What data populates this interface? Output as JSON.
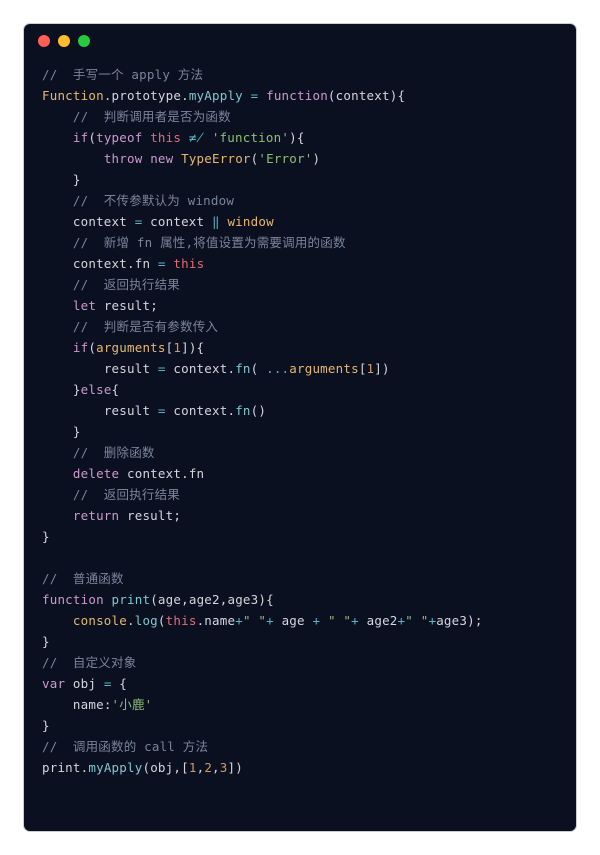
{
  "titlebar": {
    "buttons": [
      "close",
      "minimize",
      "zoom"
    ]
  },
  "code": {
    "lines": [
      [
        [
          "comment",
          "//  手写一个 apply 方法"
        ]
      ],
      [
        [
          "builtin",
          "Function"
        ],
        [
          "punct",
          "."
        ],
        [
          "prop",
          "prototype"
        ],
        [
          "punct",
          "."
        ],
        [
          "func",
          "myApply"
        ],
        [
          "ident",
          " "
        ],
        [
          "op",
          "="
        ],
        [
          "ident",
          " "
        ],
        [
          "keyword",
          "function"
        ],
        [
          "punct",
          "("
        ],
        [
          "ident",
          "context"
        ],
        [
          "punct",
          "){"
        ]
      ],
      [
        [
          "indent",
          "    "
        ],
        [
          "comment",
          "//  判断调用者是否为函数"
        ]
      ],
      [
        [
          "indent",
          "    "
        ],
        [
          "keyword",
          "if"
        ],
        [
          "punct",
          "("
        ],
        [
          "keyword",
          "typeof"
        ],
        [
          "ident",
          " "
        ],
        [
          "this",
          "this"
        ],
        [
          "ident",
          " "
        ],
        [
          "op",
          "!=="
        ],
        [
          "ident",
          " "
        ],
        [
          "string",
          "'function'"
        ],
        [
          "punct",
          "){"
        ]
      ],
      [
        [
          "indent",
          "        "
        ],
        [
          "keyword",
          "throw"
        ],
        [
          "ident",
          " "
        ],
        [
          "keyword",
          "new"
        ],
        [
          "ident",
          " "
        ],
        [
          "type",
          "TypeError"
        ],
        [
          "punct",
          "("
        ],
        [
          "string",
          "'Error'"
        ],
        [
          "punct",
          ")"
        ]
      ],
      [
        [
          "indent",
          "    "
        ],
        [
          "punct",
          "}"
        ]
      ],
      [
        [
          "indent",
          "    "
        ],
        [
          "comment",
          "//  不传参默认为 window"
        ]
      ],
      [
        [
          "indent",
          "    "
        ],
        [
          "ident",
          "context "
        ],
        [
          "op",
          "="
        ],
        [
          "ident",
          " context "
        ],
        [
          "op",
          "||"
        ],
        [
          "ident",
          " "
        ],
        [
          "builtin",
          "window"
        ]
      ],
      [
        [
          "indent",
          "    "
        ],
        [
          "comment",
          "//  新增 fn 属性,将值设置为需要调用的函数"
        ]
      ],
      [
        [
          "indent",
          "    "
        ],
        [
          "ident",
          "context"
        ],
        [
          "punct",
          "."
        ],
        [
          "prop",
          "fn"
        ],
        [
          "ident",
          " "
        ],
        [
          "op",
          "="
        ],
        [
          "ident",
          " "
        ],
        [
          "this",
          "this"
        ]
      ],
      [
        [
          "indent",
          "    "
        ],
        [
          "comment",
          "//  返回执行结果"
        ]
      ],
      [
        [
          "indent",
          "    "
        ],
        [
          "keyword",
          "let"
        ],
        [
          "ident",
          " result"
        ],
        [
          "punct",
          ";"
        ]
      ],
      [
        [
          "indent",
          "    "
        ],
        [
          "comment",
          "//  判断是否有参数传入"
        ]
      ],
      [
        [
          "indent",
          "    "
        ],
        [
          "keyword",
          "if"
        ],
        [
          "punct",
          "("
        ],
        [
          "builtin",
          "arguments"
        ],
        [
          "punct",
          "["
        ],
        [
          "number",
          "1"
        ],
        [
          "punct",
          "]){"
        ]
      ],
      [
        [
          "indent",
          "        "
        ],
        [
          "ident",
          "result "
        ],
        [
          "op",
          "="
        ],
        [
          "ident",
          " context"
        ],
        [
          "punct",
          "."
        ],
        [
          "func",
          "fn"
        ],
        [
          "punct",
          "( "
        ],
        [
          "op",
          "..."
        ],
        [
          "builtin",
          "arguments"
        ],
        [
          "punct",
          "["
        ],
        [
          "number",
          "1"
        ],
        [
          "punct",
          "])"
        ]
      ],
      [
        [
          "indent",
          "    "
        ],
        [
          "punct",
          "}"
        ],
        [
          "keyword",
          "else"
        ],
        [
          "punct",
          "{"
        ]
      ],
      [
        [
          "indent",
          "        "
        ],
        [
          "ident",
          "result "
        ],
        [
          "op",
          "="
        ],
        [
          "ident",
          " context"
        ],
        [
          "punct",
          "."
        ],
        [
          "func",
          "fn"
        ],
        [
          "punct",
          "()"
        ]
      ],
      [
        [
          "indent",
          "    "
        ],
        [
          "punct",
          "}"
        ]
      ],
      [
        [
          "indent",
          "    "
        ],
        [
          "comment",
          "//  删除函数"
        ]
      ],
      [
        [
          "indent",
          "    "
        ],
        [
          "keyword",
          "delete"
        ],
        [
          "ident",
          " context"
        ],
        [
          "punct",
          "."
        ],
        [
          "prop",
          "fn"
        ]
      ],
      [
        [
          "indent",
          "    "
        ],
        [
          "comment",
          "//  返回执行结果"
        ]
      ],
      [
        [
          "indent",
          "    "
        ],
        [
          "keyword",
          "return"
        ],
        [
          "ident",
          " result"
        ],
        [
          "punct",
          ";"
        ]
      ],
      [
        [
          "punct",
          "}"
        ]
      ],
      [
        [
          "blank",
          ""
        ]
      ],
      [
        [
          "comment",
          "//  普通函数"
        ]
      ],
      [
        [
          "keyword",
          "function"
        ],
        [
          "ident",
          " "
        ],
        [
          "func",
          "print"
        ],
        [
          "punct",
          "("
        ],
        [
          "ident",
          "age"
        ],
        [
          "punct",
          ","
        ],
        [
          "ident",
          "age2"
        ],
        [
          "punct",
          ","
        ],
        [
          "ident",
          "age3"
        ],
        [
          "punct",
          "){"
        ]
      ],
      [
        [
          "indent",
          "    "
        ],
        [
          "builtin",
          "console"
        ],
        [
          "punct",
          "."
        ],
        [
          "func",
          "log"
        ],
        [
          "punct",
          "("
        ],
        [
          "this",
          "this"
        ],
        [
          "punct",
          "."
        ],
        [
          "prop",
          "name"
        ],
        [
          "op",
          "+"
        ],
        [
          "string",
          "\" \""
        ],
        [
          "op",
          "+"
        ],
        [
          "ident",
          " age "
        ],
        [
          "op",
          "+"
        ],
        [
          "ident",
          " "
        ],
        [
          "string",
          "\" \""
        ],
        [
          "op",
          "+"
        ],
        [
          "ident",
          " age2"
        ],
        [
          "op",
          "+"
        ],
        [
          "string",
          "\" \""
        ],
        [
          "op",
          "+"
        ],
        [
          "ident",
          "age3"
        ],
        [
          "punct",
          ");"
        ]
      ],
      [
        [
          "punct",
          "}"
        ]
      ],
      [
        [
          "comment",
          "//  自定义对象"
        ]
      ],
      [
        [
          "keyword",
          "var"
        ],
        [
          "ident",
          " obj "
        ],
        [
          "op",
          "="
        ],
        [
          "ident",
          " "
        ],
        [
          "punct",
          "{"
        ]
      ],
      [
        [
          "indent",
          "    "
        ],
        [
          "prop",
          "name"
        ],
        [
          "punct",
          ":"
        ],
        [
          "string",
          "'小鹿'"
        ]
      ],
      [
        [
          "punct",
          "}"
        ]
      ],
      [
        [
          "comment",
          "//  调用函数的 call 方法"
        ]
      ],
      [
        [
          "ident",
          "print"
        ],
        [
          "punct",
          "."
        ],
        [
          "func",
          "myApply"
        ],
        [
          "punct",
          "("
        ],
        [
          "ident",
          "obj"
        ],
        [
          "punct",
          ",["
        ],
        [
          "number",
          "1"
        ],
        [
          "punct",
          ","
        ],
        [
          "number",
          "2"
        ],
        [
          "punct",
          ","
        ],
        [
          "number",
          "3"
        ],
        [
          "punct",
          "])"
        ]
      ]
    ]
  }
}
